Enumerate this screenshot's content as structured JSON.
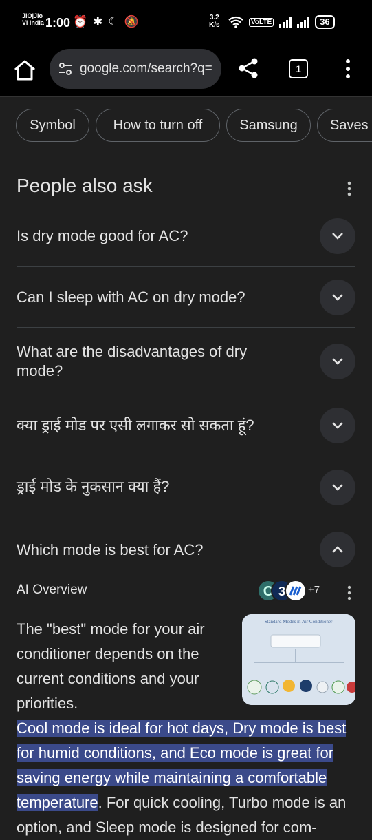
{
  "status_bar": {
    "carrier_line1": "JIO|Jio",
    "carrier_line2": "Vi India",
    "time": "1:00",
    "speed_value": "3.2",
    "speed_unit": "K/s",
    "volte": "VoLTE",
    "battery": "36"
  },
  "browser": {
    "url": "google.com/search?q=",
    "tab_count": "1"
  },
  "chips": [
    "Symbol",
    "How to turn off",
    "Samsung",
    "Saves"
  ],
  "paa": {
    "title": "People also ask",
    "questions": [
      "Is dry mode good for AC?",
      "Can I sleep with AC on dry mode?",
      "What are the disadvantages of dry mode?",
      "क्या ड्राई मोड पर एसी लगाकर सो सकता हूं?",
      "ड्राई मोड के नुकसान क्या हैं?",
      "Which mode is best for AC?"
    ]
  },
  "ai_overview": {
    "label": "AI Overview",
    "source_count": "+7",
    "thumbnail_title": "Standard Modes in Air Conditioner",
    "text_intro": "The \"best\" mode for your air conditioner depends on the current conditions and your priorities.",
    "text_highlight": "Cool mode is ideal for hot days, Dry mode is best for humid conditions, and Eco mode is great for saving energy while maintaining a comfortable temperature",
    "text_after": ". For quick cooling, Turbo mode is an option, and Sleep mode is designed for com-"
  },
  "colors": {
    "background": "#1f1f1f",
    "highlight": "#3b4a8a",
    "divider": "#3c4043"
  }
}
